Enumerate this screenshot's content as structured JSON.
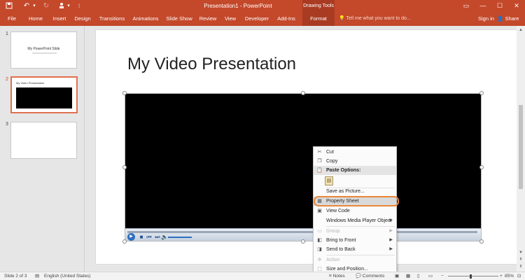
{
  "titlebar": {
    "title": "Presentation1 - PowerPoint",
    "context_group": "Drawing Tools",
    "save_icon": "floppy-disk-icon",
    "undo_icon": "undo-icon",
    "redo_icon": "redo-icon",
    "present_icon": "presenter-icon",
    "window_controls": [
      "restore-ribbon-icon",
      "minimize-icon",
      "maximize-icon",
      "close-icon"
    ]
  },
  "ribbon": {
    "tabs": [
      {
        "label": "File"
      },
      {
        "label": "Home"
      },
      {
        "label": "Insert"
      },
      {
        "label": "Design"
      },
      {
        "label": "Transitions"
      },
      {
        "label": "Animations"
      },
      {
        "label": "Slide Show"
      },
      {
        "label": "Review"
      },
      {
        "label": "View"
      },
      {
        "label": "Developer"
      },
      {
        "label": "Add-Ins"
      },
      {
        "label": "Format"
      }
    ],
    "tell_me": "Tell me what you want to do...",
    "sign_in": "Sign in",
    "share": "Share"
  },
  "thumbnails": [
    {
      "number": "1",
      "title": "My PowerPoint Slide"
    },
    {
      "number": "2",
      "title": "My Video Presentation"
    },
    {
      "number": "3",
      "title": ""
    }
  ],
  "slide": {
    "title": "My Video Presentation"
  },
  "context_menu": {
    "items": [
      {
        "label": "Cut",
        "icon": "scissors-icon"
      },
      {
        "label": "Copy",
        "icon": "copy-icon"
      },
      {
        "label": "Paste Options:",
        "icon": "paste-icon"
      },
      {
        "label": "Save as Picture...",
        "icon": ""
      },
      {
        "label": "Property Sheet",
        "icon": "property-sheet-icon"
      },
      {
        "label": "View Code",
        "icon": "view-code-icon"
      },
      {
        "label": "Windows Media Player Object",
        "icon": ""
      },
      {
        "label": "Group",
        "icon": "group-icon"
      },
      {
        "label": "Bring to Front",
        "icon": "bring-to-front-icon"
      },
      {
        "label": "Send to Back",
        "icon": "send-to-back-icon"
      },
      {
        "label": "Action",
        "icon": "action-icon"
      },
      {
        "label": "Size and Position...",
        "icon": "size-position-icon"
      }
    ]
  },
  "statusbar": {
    "slide_info": "Slide 2 of 3",
    "language": "English (United States)",
    "notes": "Notes",
    "comments": "Comments",
    "zoom": "85%"
  },
  "colors": {
    "accent": "#c4482a",
    "highlight_ring": "#e8883c"
  }
}
